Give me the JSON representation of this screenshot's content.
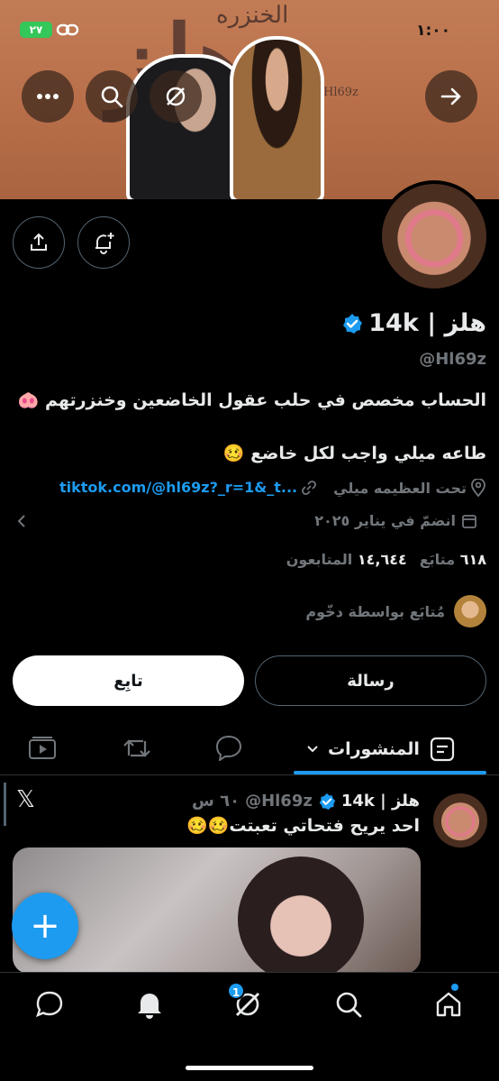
{
  "status_bar": {
    "time": "١:٠٠",
    "battery": "٢٧"
  },
  "banner": {
    "title_small": "الخنزره",
    "title_big": "هلز",
    "handle": "@Hl69z"
  },
  "profile": {
    "name": "هلز | 14k",
    "handle": "@Hl69z",
    "bio_line1": "الحساب مخصص في حلب عقول الخاضعين وخنزرتهم 🐽",
    "bio_line2": "طاعه ميلي واجب لكل خاضع 🥴",
    "location": "تحت العظيمه ميلي",
    "website": "tiktok.com/@hl69z?_r=1&_t...",
    "joined": "انضمّ في يناير ٢٠٢٥",
    "following_count": "٦١٨",
    "following_label": "متابَع",
    "followers_count": "١٤,٦٤٤",
    "followers_label": "المتابعون",
    "followed_by": "مُتابَع بواسطة دخّوم"
  },
  "actions": {
    "follow": "تابِع",
    "message": "رسالة"
  },
  "tabs": {
    "posts": "المنشورات"
  },
  "tweet": {
    "name": "هلز | 14k",
    "handle": "@Hl69z",
    "time": "٦٠ س",
    "text": "احد يريح فتحاتي تعبتت🥴🥴",
    "x_logo": "𝕏"
  },
  "fab": {
    "label": "+"
  },
  "nav": {
    "notification_badge": "1"
  },
  "colors": {
    "accent": "#1d9bf0",
    "background": "#000000",
    "muted": "#71767b"
  }
}
